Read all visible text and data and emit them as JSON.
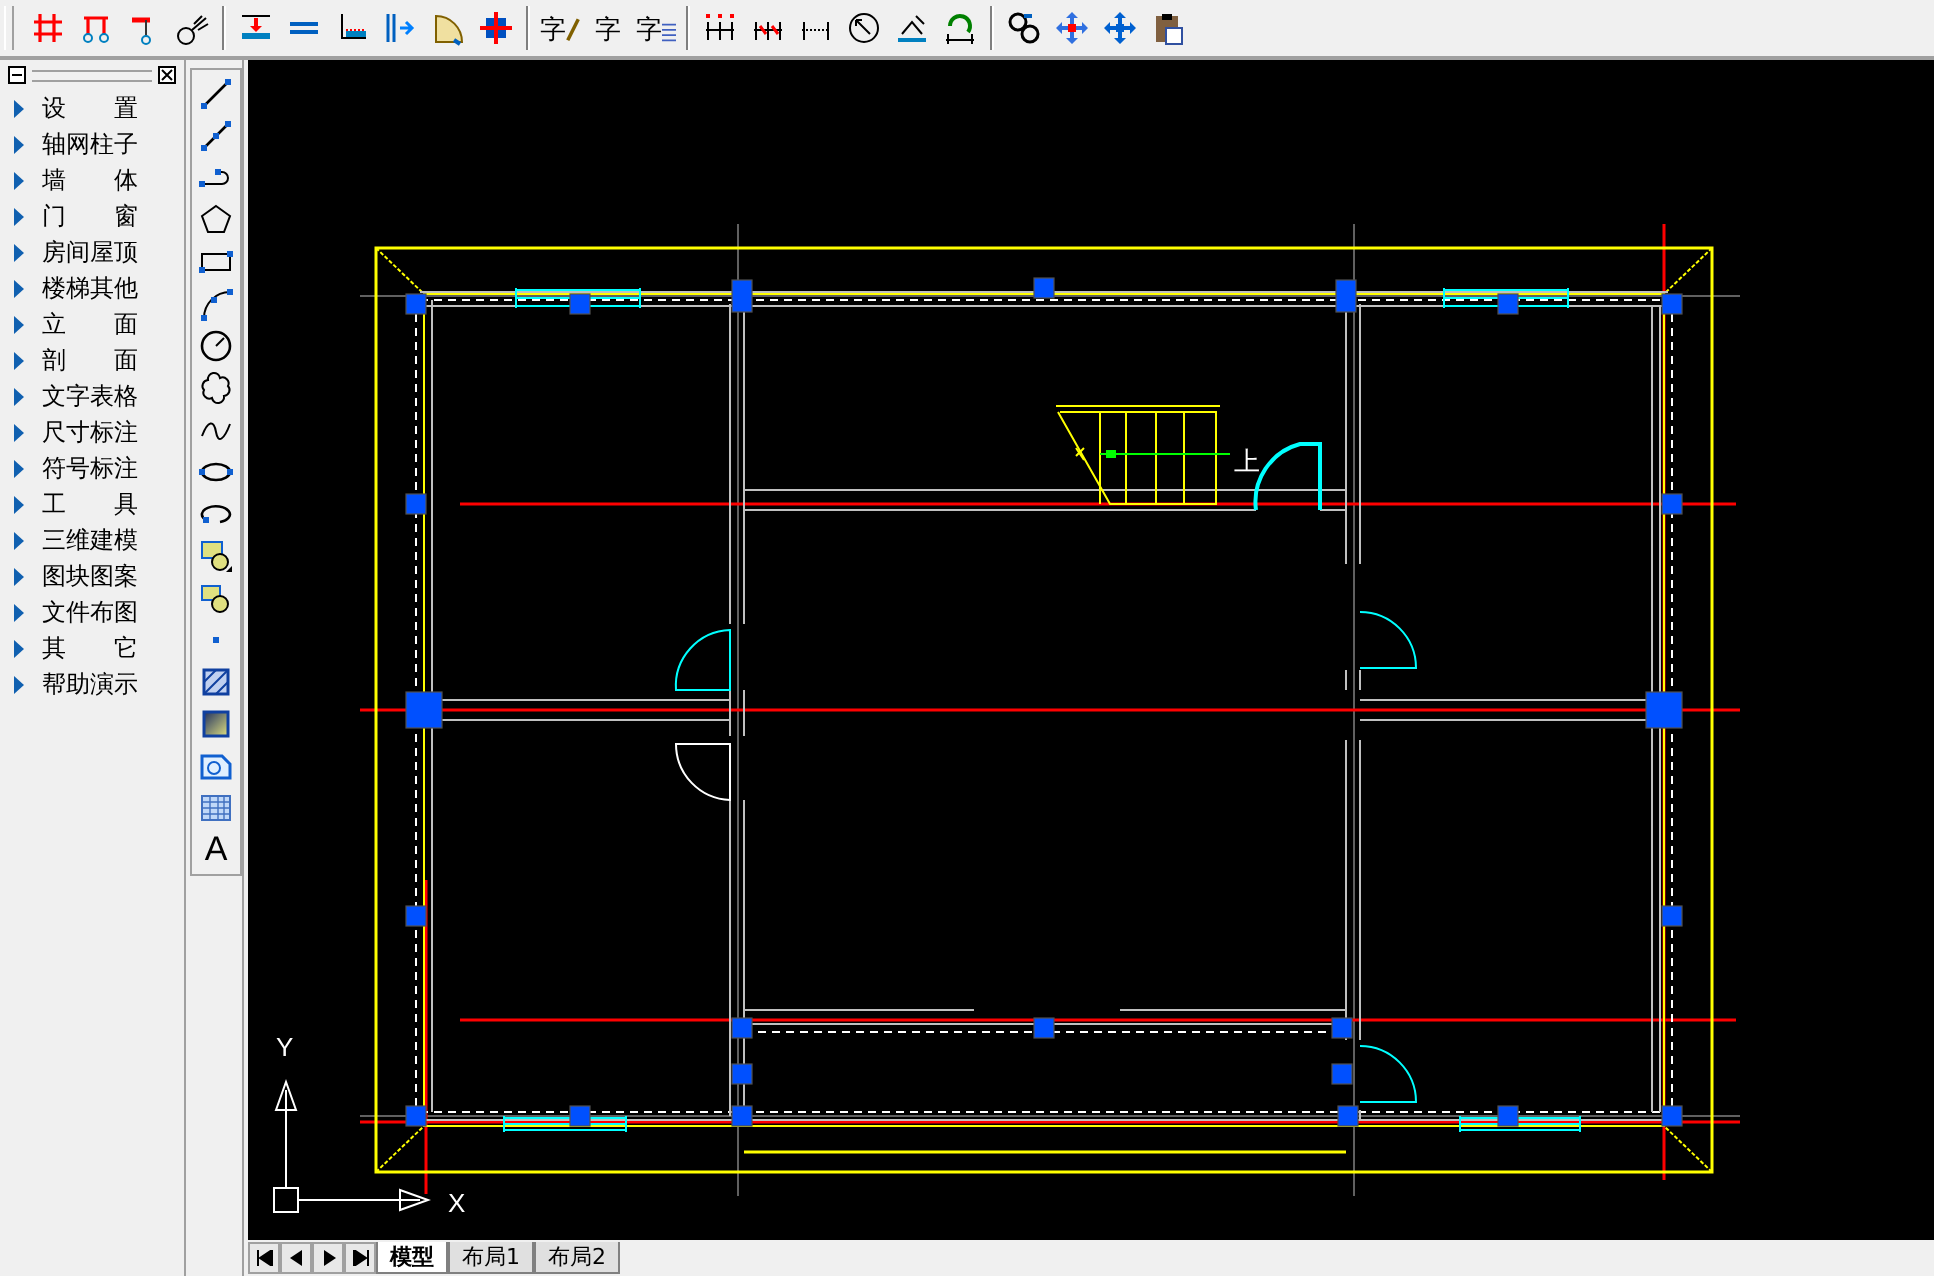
{
  "toolbar": [
    {
      "kind": "grid"
    },
    {
      "kind": "column-axis"
    },
    {
      "kind": "column-single"
    },
    {
      "kind": "axis-number"
    },
    {
      "kind": "separator"
    },
    {
      "kind": "wall-dim"
    },
    {
      "kind": "wall"
    },
    {
      "kind": "floor-line"
    },
    {
      "kind": "mirror"
    },
    {
      "kind": "arch"
    },
    {
      "kind": "column-block"
    },
    {
      "kind": "separator"
    },
    {
      "kind": "glyph-pen",
      "glyph": "字"
    },
    {
      "kind": "glyph",
      "glyph": "字"
    },
    {
      "kind": "glyph-table",
      "glyph": "字"
    },
    {
      "kind": "separator"
    },
    {
      "kind": "dim-points"
    },
    {
      "kind": "dim-slashed"
    },
    {
      "kind": "dim-dotted"
    },
    {
      "kind": "circle-arrow"
    },
    {
      "kind": "elevation"
    },
    {
      "kind": "rotate-dim"
    },
    {
      "kind": "separator"
    },
    {
      "kind": "chain-link"
    },
    {
      "kind": "move-arrows"
    },
    {
      "kind": "move-cross"
    },
    {
      "kind": "clipboard"
    }
  ],
  "menu": [
    {
      "label": "设 置"
    },
    {
      "label": "轴网柱子"
    },
    {
      "label": "墙 体"
    },
    {
      "label": "门 窗"
    },
    {
      "label": "房间屋顶"
    },
    {
      "label": "楼梯其他"
    },
    {
      "label": "立 面"
    },
    {
      "label": "剖 面"
    },
    {
      "label": "文字表格"
    },
    {
      "label": "尺寸标注"
    },
    {
      "label": "符号标注"
    },
    {
      "label": "工 具"
    },
    {
      "label": "三维建模"
    },
    {
      "label": "图块图案"
    },
    {
      "label": "文件布图"
    },
    {
      "label": "其 它"
    },
    {
      "label": "帮助演示"
    }
  ],
  "draw_tools": [
    {
      "kind": "line"
    },
    {
      "kind": "polyline"
    },
    {
      "kind": "arc-arrow"
    },
    {
      "kind": "pentagon"
    },
    {
      "kind": "rectangle"
    },
    {
      "kind": "arc"
    },
    {
      "kind": "circle"
    },
    {
      "kind": "cloud"
    },
    {
      "kind": "spline"
    },
    {
      "kind": "ellipse"
    },
    {
      "kind": "ellipse-arc"
    },
    {
      "kind": "block-insert"
    },
    {
      "kind": "block-make"
    },
    {
      "kind": "point"
    },
    {
      "kind": "hatch"
    },
    {
      "kind": "gradient"
    },
    {
      "kind": "region"
    },
    {
      "kind": "table"
    },
    {
      "kind": "text",
      "glyph": "A"
    }
  ],
  "canvas": {
    "stair_label": "上",
    "ucs": {
      "x_label": "X",
      "y_label": "Y"
    }
  },
  "layout_tabs": [
    {
      "label": "模型",
      "selected": true
    },
    {
      "label": "布局1",
      "selected": false
    },
    {
      "label": "布局2",
      "selected": false
    }
  ]
}
